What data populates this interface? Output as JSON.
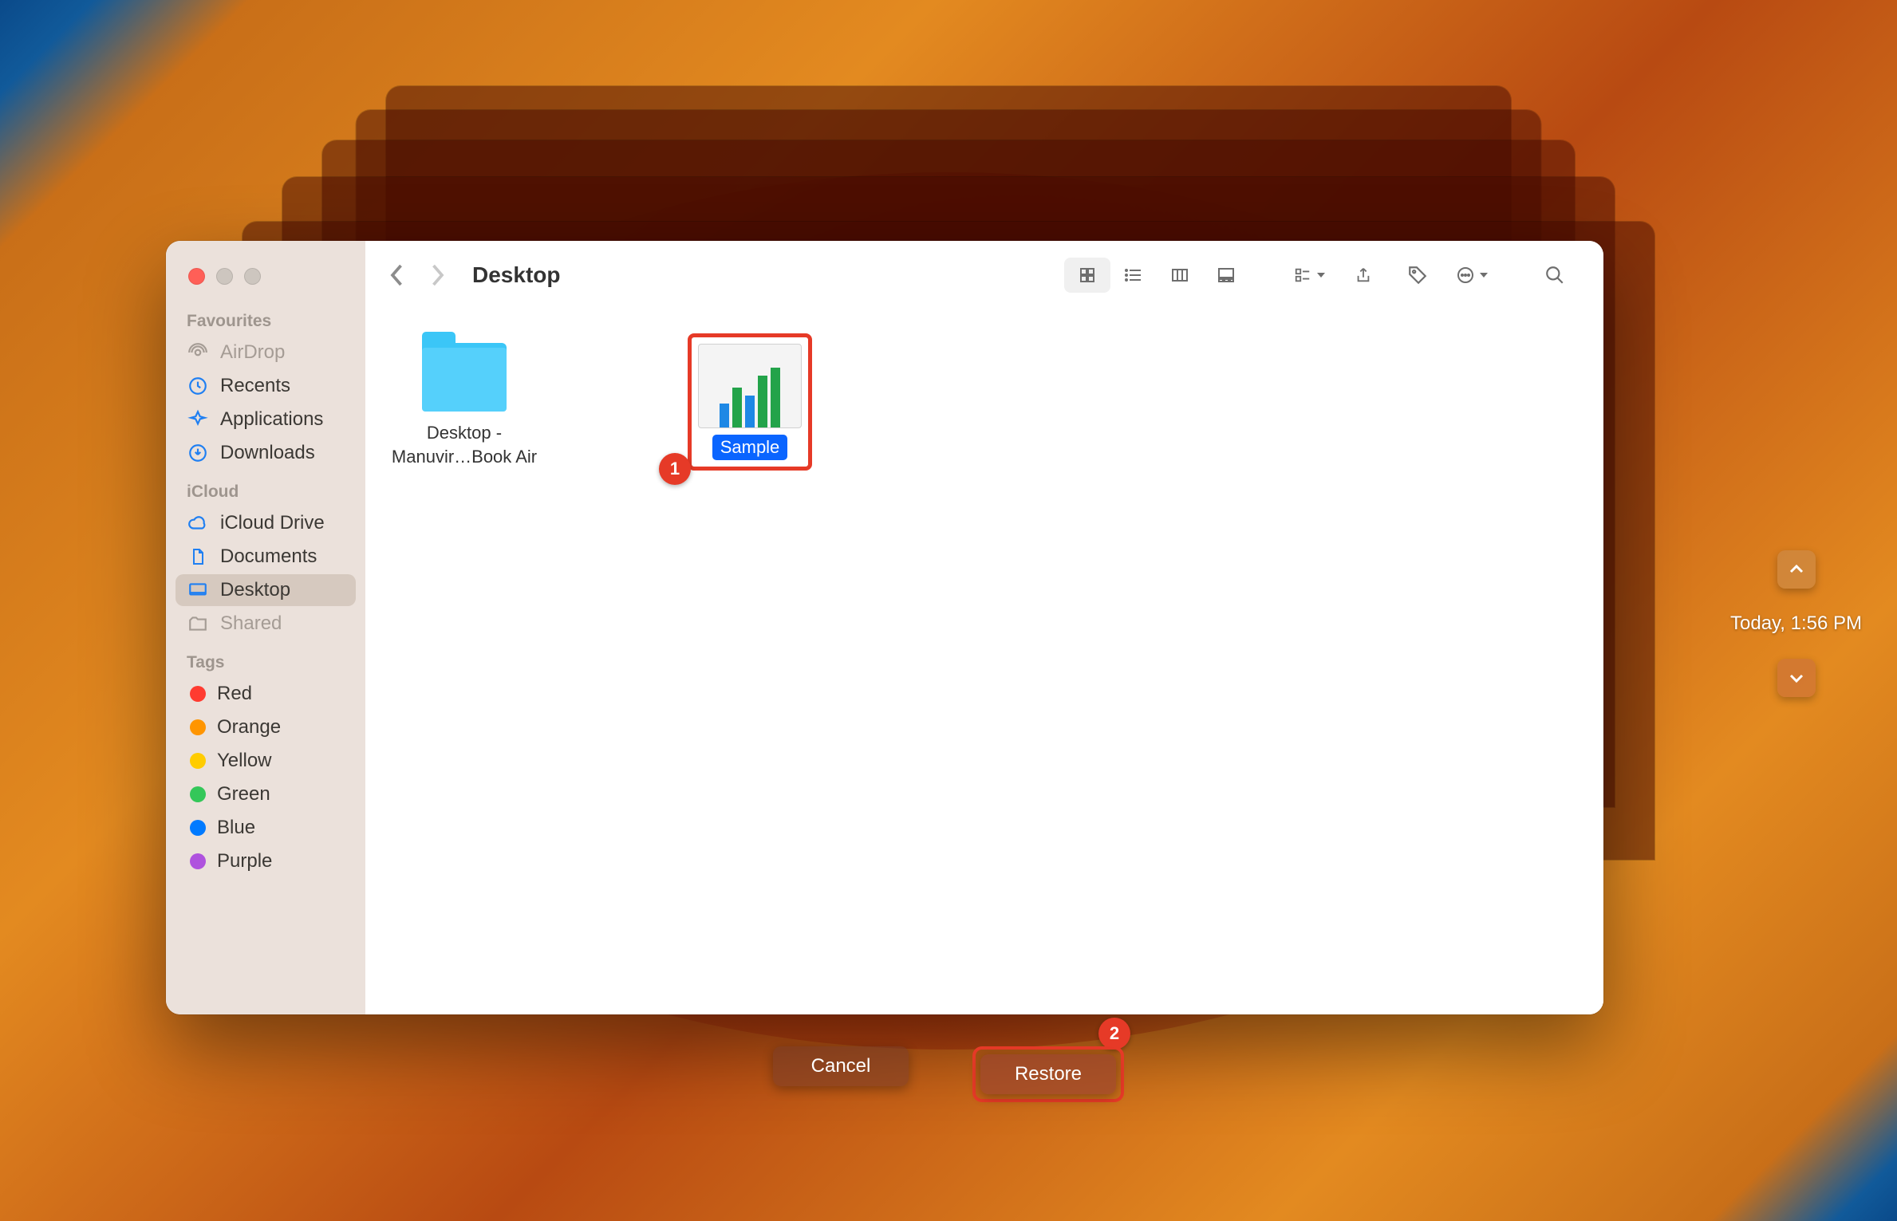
{
  "window": {
    "title": "Desktop"
  },
  "sidebar": {
    "sections": {
      "favourites": {
        "header": "Favourites",
        "items": [
          {
            "label": "AirDrop"
          },
          {
            "label": "Recents"
          },
          {
            "label": "Applications"
          },
          {
            "label": "Downloads"
          }
        ]
      },
      "icloud": {
        "header": "iCloud",
        "items": [
          {
            "label": "iCloud Drive"
          },
          {
            "label": "Documents"
          },
          {
            "label": "Desktop"
          },
          {
            "label": "Shared"
          }
        ]
      },
      "tags": {
        "header": "Tags",
        "items": [
          {
            "label": "Red",
            "color": "#ff3b30"
          },
          {
            "label": "Orange",
            "color": "#ff9500"
          },
          {
            "label": "Yellow",
            "color": "#ffcc00"
          },
          {
            "label": "Green",
            "color": "#34c759"
          },
          {
            "label": "Blue",
            "color": "#007aff"
          },
          {
            "label": "Purple",
            "color": "#af52de"
          }
        ]
      }
    }
  },
  "files": {
    "folder": {
      "label": "Desktop - Manuvir…Book Air"
    },
    "selected": {
      "label": "Sample"
    }
  },
  "buttons": {
    "cancel": "Cancel",
    "restore": "Restore"
  },
  "time_travel": {
    "current": "Today, 1:56 PM"
  },
  "annotations": {
    "step1": "1",
    "step2": "2"
  }
}
